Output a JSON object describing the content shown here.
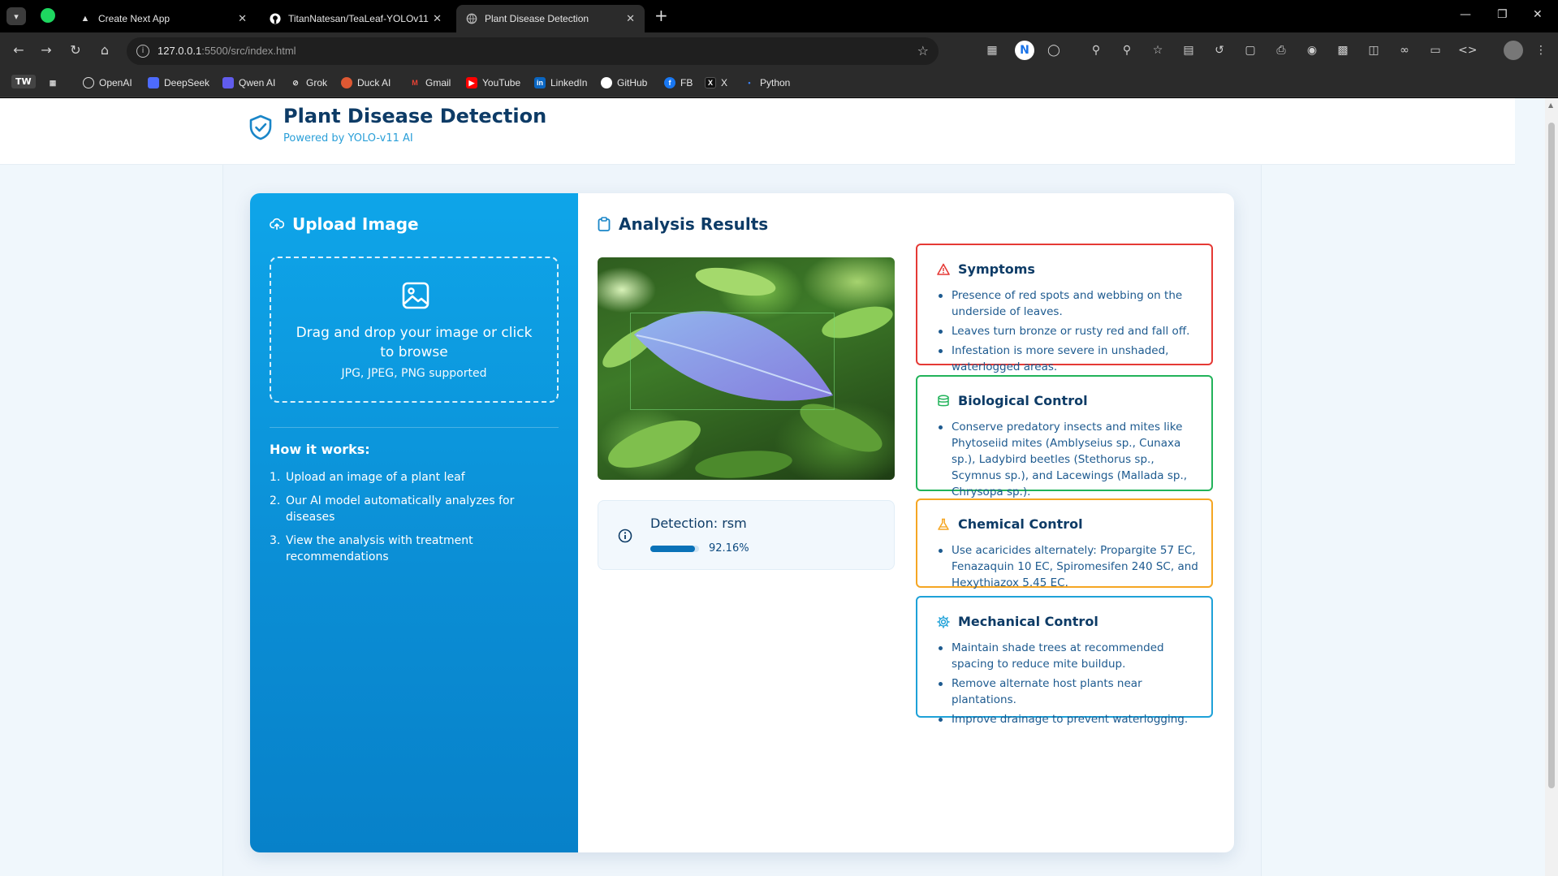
{
  "browser": {
    "tabs": [
      {
        "title": "Create Next App",
        "active": false
      },
      {
        "title": "TitanNatesan/TeaLeaf-YOLOv11",
        "active": false
      },
      {
        "title": "Plant Disease Detection",
        "active": true
      }
    ],
    "url_host": "127.0.0.1",
    "url_rest": ":5500/src/index.html",
    "profile_badge": "TW",
    "bookmarks": [
      "OpenAI",
      "DeepSeek",
      "Qwen AI",
      "Grok",
      "Duck AI",
      "Gmail",
      "YouTube",
      "LinkedIn",
      "GitHub",
      "FB",
      "X",
      "Python"
    ]
  },
  "header": {
    "title": "Plant Disease Detection",
    "subtitle": "Powered by YOLO-v11 AI"
  },
  "upload": {
    "title": "Upload Image",
    "dropzone_text": "Drag and drop your image or click to browse",
    "dropzone_hint": "JPG, JPEG, PNG supported",
    "how_title": "How it works:",
    "steps": [
      {
        "num": "1.",
        "text": "Upload an image of a plant leaf"
      },
      {
        "num": "2.",
        "text": "Our AI model automatically analyzes for diseases"
      },
      {
        "num": "3.",
        "text": "View the analysis with treatment recommendations"
      }
    ]
  },
  "results": {
    "title": "Analysis Results",
    "detection_label": "Detection: rsm",
    "confidence_text": "92.16%",
    "confidence": 0.9216,
    "cards": {
      "symptoms": {
        "title": "Symptoms",
        "color": "#e53935",
        "items": [
          "Presence of red spots and webbing on the underside of leaves.",
          "Leaves turn bronze or rusty red and fall off.",
          "Infestation is more severe in unshaded, waterlogged areas."
        ]
      },
      "biological": {
        "title": "Biological Control",
        "color": "#22b35a",
        "items": [
          "Conserve predatory insects and mites like Phytoseiid mites (Amblyseius sp., Cunaxa sp.), Ladybird beetles (Stethorus sp., Scymnus sp.), and Lacewings (Mallada sp., Chrysopa sp.)."
        ]
      },
      "chemical": {
        "title": "Chemical Control",
        "color": "#f5a623",
        "items": [
          "Use acaricides alternately: Propargite 57 EC, Fenazaquin 10 EC, Spiromesifen 240 SC, and Hexythiazox 5.45 EC."
        ]
      },
      "mechanical": {
        "title": "Mechanical Control",
        "color": "#1ea1d8",
        "items": [
          "Maintain shade trees at recommended spacing to reduce mite buildup.",
          "Remove alternate host plants near plantations.",
          "Improve drainage to prevent waterlogging."
        ]
      }
    }
  }
}
